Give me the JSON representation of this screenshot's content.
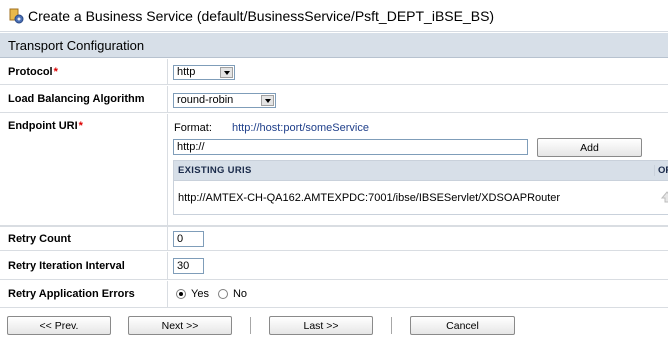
{
  "window": {
    "title": "Create a Business Service (default/BusinessService/Psft_DEPT_iBSE_BS)"
  },
  "section": {
    "title": "Transport Configuration"
  },
  "form": {
    "protocol": {
      "label": "Protocol",
      "required": "*",
      "value": "http"
    },
    "load_balancing": {
      "label": "Load Balancing Algorithm",
      "value": "round-robin"
    },
    "endpoint": {
      "label": "Endpoint URI",
      "required": "*",
      "format_label": "Format:",
      "format_value": "http://host:port/someService",
      "input_value": "http://",
      "add_label": "Add",
      "table_header": "EXISTING URIS",
      "ops_header": "OP",
      "uris": [
        "http://AMTEX-CH-QA162.AMTEXPDC:7001/ibse/IBSEServlet/XDSOAPRouter"
      ]
    },
    "retry_count": {
      "label": "Retry Count",
      "value": "0"
    },
    "retry_interval": {
      "label": "Retry Iteration Interval",
      "value": "30"
    },
    "retry_app_errors": {
      "label": "Retry Application Errors",
      "yes": "Yes",
      "no": "No",
      "selected": "Yes"
    }
  },
  "buttons": {
    "prev": "<< Prev.",
    "next": "Next >>",
    "last": "Last >>",
    "cancel": "Cancel"
  },
  "colors": {
    "section_bg": "#d7dfe8",
    "link": "#1f3f8a",
    "required": "#dd0000"
  }
}
